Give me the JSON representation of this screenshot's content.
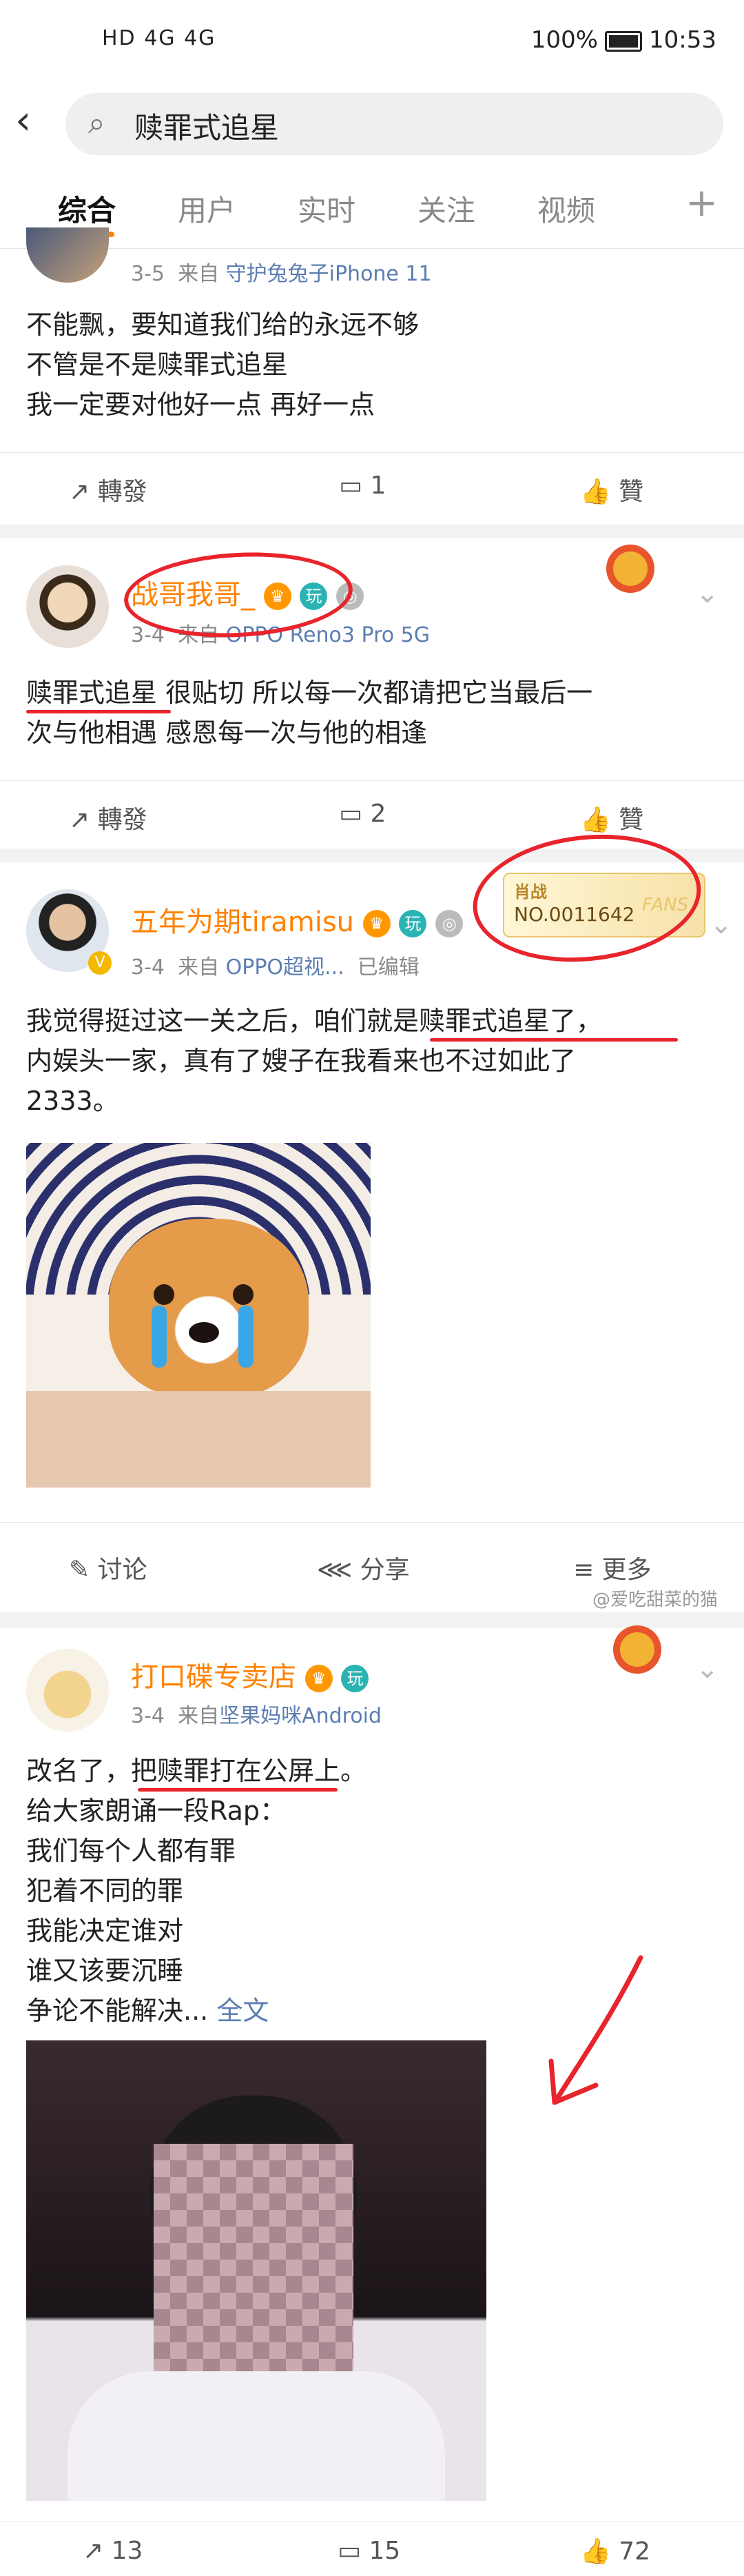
{
  "status": {
    "left": "HD 4G 4G",
    "battery": "100%",
    "time": "10:53"
  },
  "search": {
    "query": "赎罪式追星"
  },
  "tabs": [
    "综合",
    "用户",
    "实时",
    "关注",
    "视频"
  ],
  "post1": {
    "date": "3-5",
    "from": "来自",
    "source": "守护兔兔子iPhone 11",
    "lines": [
      "不能飘，要知道我们给的永远不够",
      "不管是不是赎罪式追星",
      "我一定要对他好一点 再好一点"
    ],
    "repost": "轉發",
    "comments": "1",
    "like": "贊"
  },
  "post2": {
    "username": "战哥我哥_",
    "date": "3-4",
    "from": "来自",
    "source": "OPPO Reno3 Pro 5G",
    "lines": [
      "赎罪式追星 很贴切 所以每一次都请把它当最后一",
      "次与他相遇 感恩每一次与他的相逢"
    ],
    "repost": "轉發",
    "comments": "2",
    "like": "贊"
  },
  "post3": {
    "username": "五年为期tiramisu",
    "date": "3-4",
    "from": "来自",
    "source": "OPPO超视...",
    "edited": "已编辑",
    "fan_title": "肖战",
    "fan_no": "NO.0011642",
    "fan_tag": "FANS",
    "lines": [
      "我觉得挺过这一关之后，咱们就是赎罪式追星了，",
      "内娱头一家，真有了嫂子在我看来也不过如此了",
      "2333。"
    ],
    "discuss": "讨论",
    "share": "分享",
    "more": "更多"
  },
  "post4": {
    "username": "打口碟专卖店",
    "date": "3-4",
    "from": "来自",
    "source": "坚果妈咪Android",
    "lines": [
      "改名了，把赎罪打在公屏上。",
      "给大家朗诵一段Rap：",
      "我们每个人都有罪",
      "犯着不同的罪",
      "我能决定谁对",
      "谁又该要沉睡"
    ],
    "last_line": "争论不能解决...",
    "full_text": "全文",
    "reposts": "13",
    "comments": "15",
    "likes": "72"
  },
  "watermark": "@爱吃甜菜的猫"
}
